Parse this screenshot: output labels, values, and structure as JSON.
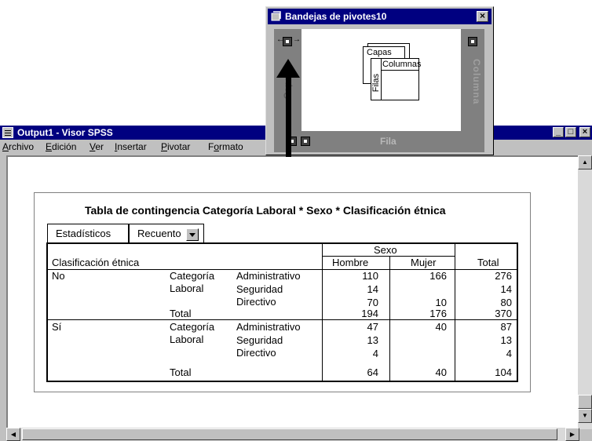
{
  "main_window": {
    "title": "Output1 - Visor SPSS",
    "controls": {
      "minimize": "_",
      "maximize": "□",
      "close": "×"
    },
    "menu": [
      {
        "label": "Archivo",
        "hotkey": "A"
      },
      {
        "label": "Edición",
        "hotkey": "E"
      },
      {
        "label": "Ver",
        "hotkey": "V"
      },
      {
        "label": "Insertar",
        "hotkey": "I"
      },
      {
        "label": "Pivotar",
        "hotkey": "P"
      },
      {
        "label": "Formato",
        "hotkey": "o"
      }
    ]
  },
  "pivot_table": {
    "title": "Tabla de contingencia Categoría Laboral * Sexo * Clasificación étnica",
    "layer": {
      "label": "Estadísticos",
      "value": "Recuento"
    },
    "header": {
      "row_dim": "Clasificación étnica",
      "col_group": "Sexo",
      "cols": [
        "Hombre",
        "Mujer"
      ],
      "total": "Total"
    },
    "groups": [
      {
        "ethnic": "No",
        "var_label_1": "Categoría",
        "var_label_2": "Laboral",
        "rows": [
          {
            "label": "Administrativo",
            "hombre": "110",
            "mujer": "166",
            "total": "276"
          },
          {
            "label": "Seguridad",
            "hombre": "14",
            "mujer": "",
            "total": "14"
          },
          {
            "label": "Directivo",
            "hombre": "70",
            "mujer": "10",
            "total": "80"
          }
        ],
        "total_row": {
          "label": "Total",
          "hombre": "194",
          "mujer": "176",
          "total": "370"
        }
      },
      {
        "ethnic": "Sí",
        "var_label_1": "Categoría",
        "var_label_2": "Laboral",
        "rows": [
          {
            "label": "Administrativo",
            "hombre": "47",
            "mujer": "40",
            "total": "87"
          },
          {
            "label": "Seguridad",
            "hombre": "13",
            "mujer": "",
            "total": "13"
          },
          {
            "label": "Directivo",
            "hombre": "4",
            "mujer": "",
            "total": "4"
          }
        ],
        "total_row": {
          "label": "Total",
          "hombre": "64",
          "mujer": "40",
          "total": "104"
        }
      }
    ]
  },
  "pivot_trays": {
    "title": "Bandejas de pivotes10",
    "close": "×",
    "layer_tray_label": "Capa",
    "column_tray_label": "Columna",
    "row_tray_label": "Fila",
    "schematic": {
      "layers": "Capas",
      "columns": "Columnas",
      "rows": "Filas"
    }
  }
}
